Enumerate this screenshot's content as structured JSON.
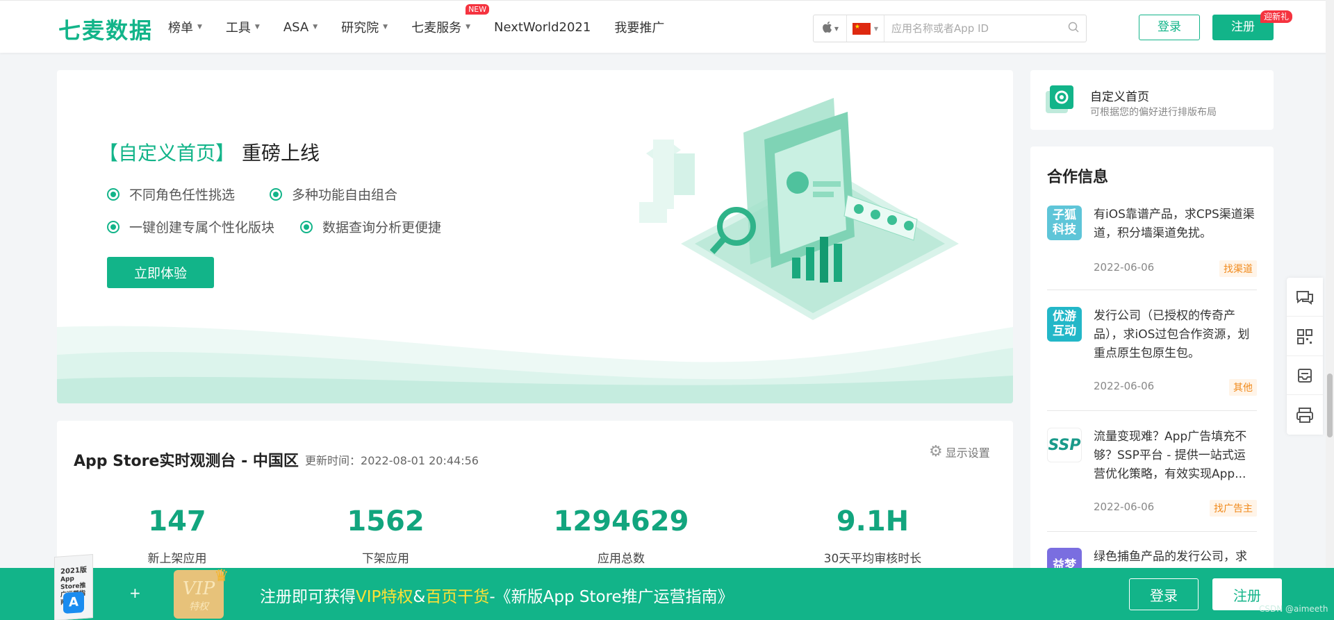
{
  "nav": {
    "logo": "七麦数据",
    "items": [
      {
        "label": "榜单",
        "caret": "▼"
      },
      {
        "label": "工具",
        "caret": "▼"
      },
      {
        "label": "ASA",
        "caret": "▼"
      },
      {
        "label": "研究院",
        "caret": "▼"
      },
      {
        "label": "七麦服务",
        "caret": "▼",
        "badge": "NEW"
      },
      {
        "label": "NextWorld2021"
      },
      {
        "label": "我要推广"
      }
    ],
    "search_placeholder": "应用名称或者App ID",
    "login": "登录",
    "register": "注册",
    "register_badge": "迎新礼"
  },
  "banner": {
    "title_highlight": "【自定义首页】",
    "title_rest": "重磅上线",
    "features": [
      "不同角色任性挑选",
      "多种功能自由组合",
      "一键创建专属个性化版块",
      "数据查询分析更便捷"
    ],
    "cta": "立即体验"
  },
  "monitor": {
    "title": "App Store实时观测台 - 中国区",
    "updated_label": "更新时间：",
    "updated_time": "2022-08-01 20:44:56",
    "settings": "显示设置",
    "stats": [
      {
        "value": "147",
        "label": "新上架应用"
      },
      {
        "value": "1562",
        "label": "下架应用"
      },
      {
        "value": "1294629",
        "label": "应用总数"
      },
      {
        "value": "9.1H",
        "label": "30天平均审核时长"
      }
    ]
  },
  "custom_card": {
    "title": "自定义首页",
    "subtitle": "可根据您的偏好进行排版布局"
  },
  "coop": {
    "title": "合作信息",
    "items": [
      {
        "logo": "子狐科技",
        "logo_color": "#5ec5d8",
        "text": "有iOS靠谱产品，求CPS渠道渠道，积分墙渠道免扰。",
        "date": "2022-06-06",
        "tag": "找渠道"
      },
      {
        "logo": "优游互动",
        "logo_color": "#23b7c8",
        "text": "发行公司（已授权的传奇产品），求iOS过包合作资源，划重点原生包原生包。",
        "date": "2022-06-06",
        "tag": "其他"
      },
      {
        "logo": "SSP",
        "logo_color": "#ffffff",
        "text": "流量变现难？App广告填充不够？SSP平台 - 提供一站式运营优化策略，有效实现App...",
        "date": "2022-06-06",
        "tag": "找广告主"
      },
      {
        "logo": "益梦",
        "logo_color": "#7a6ee0",
        "text": "绿色捕鱼产品的发行公司，求",
        "date": "",
        "tag": ""
      }
    ]
  },
  "bottom": {
    "book_year": "2021版",
    "book_sub": "App Store推广运营指南",
    "plus": "+",
    "vip_main": "VIP",
    "vip_sub": "特权",
    "promo_a": "注册即可获得",
    "promo_b": "VIP特权",
    "promo_c": "&",
    "promo_d": "百页干货",
    "promo_e": "-《新版App Store推广运营指南》",
    "login": "登录",
    "register": "注册",
    "watermark": "CSDN @aimeeth"
  },
  "colors": {
    "brand": "#12b489",
    "bar": "#12b489",
    "tag": "#f08a1c"
  }
}
